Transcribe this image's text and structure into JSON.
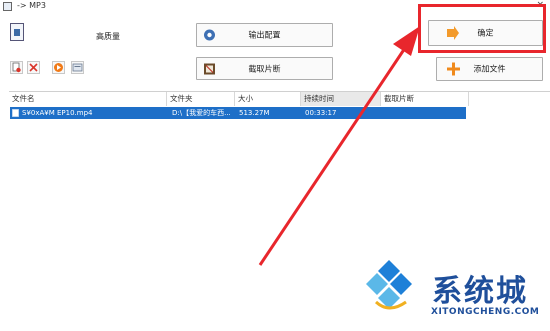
{
  "window": {
    "title": "-> MP3",
    "close_glyph": "×"
  },
  "preset": {
    "quality_label": "高质量"
  },
  "buttons": {
    "output_config": "输出配置",
    "clip": "截取片断",
    "confirm": "确定",
    "add_file": "添加文件"
  },
  "toolbar_icons": [
    "delete-file-icon",
    "remove-icon",
    "play-icon",
    "settings-icon"
  ],
  "file_list": {
    "columns": [
      "文件名",
      "文件夹",
      "大小",
      "持续时间",
      "截取片断"
    ],
    "rows": [
      {
        "name": "S¥0xA¥M EP10.mp4",
        "folder": "D:\\【我爱的车西...",
        "size": "513.27M",
        "duration": "00:33:17",
        "clip": ""
      }
    ]
  },
  "watermark": {
    "text": "系统城",
    "url": "XITONGCHENG.COM"
  },
  "colors": {
    "highlight": "#e8262c",
    "selection": "#1e6fc8",
    "watermark": "#1f4f9b"
  }
}
